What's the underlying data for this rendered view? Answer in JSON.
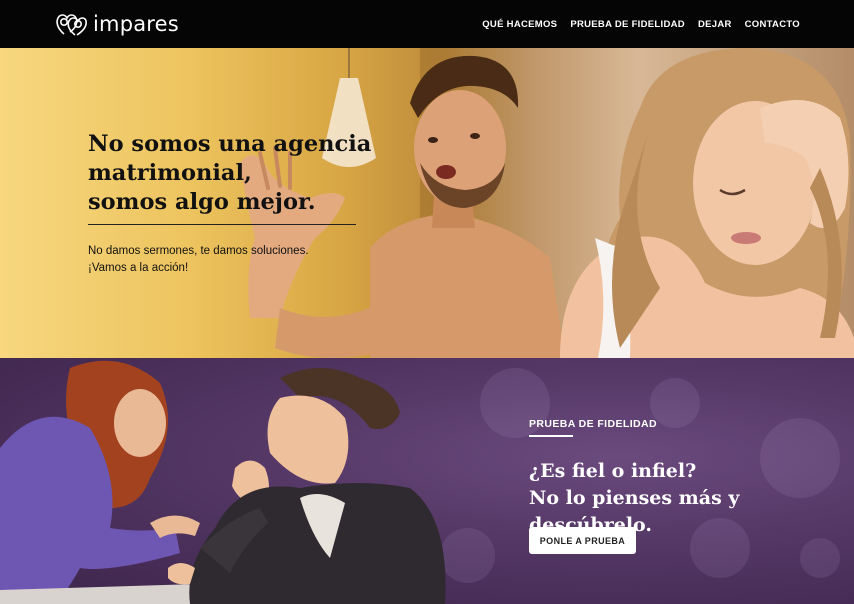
{
  "header": {
    "logo_text": "impares",
    "nav": [
      {
        "label": "QUÉ HACEMOS"
      },
      {
        "label": "PRUEBA DE FIDELIDAD"
      },
      {
        "label": "DEJAR"
      },
      {
        "label": "CONTACTO"
      }
    ]
  },
  "hero": {
    "title": "No somos una agencia\nmatrimonial,\nsomos algo mejor.",
    "subtitle": "No damos sermones, te damos soluciones.\n¡Vamos a la acción!"
  },
  "fidelity": {
    "label": "PRUEBA DE FIDELIDAD",
    "title": "¿Es fiel o infiel?\nNo lo pienses más y descúbrelo.",
    "button_label": "PONLE A PRUEBA"
  },
  "colors": {
    "header_bg": "#050505",
    "hero_bg": "#edc45f",
    "section_bg": "#533664",
    "button_bg": "#ffffff"
  },
  "icons": {
    "logo": "intertwined-hearts-icon"
  }
}
